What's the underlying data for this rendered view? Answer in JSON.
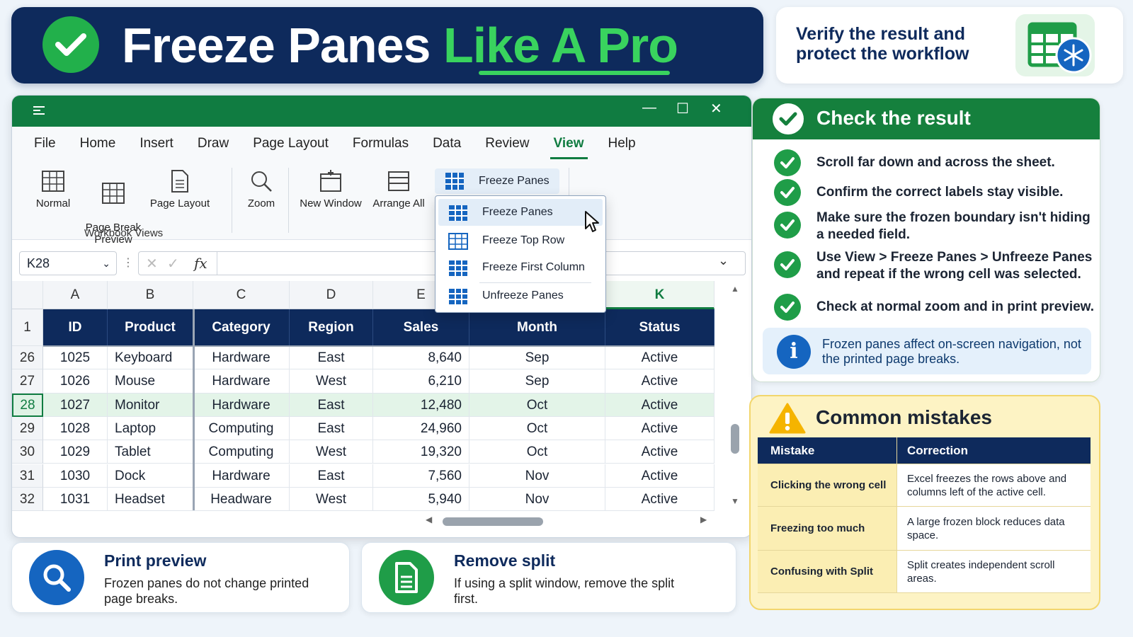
{
  "title": {
    "main": "Freeze Panes",
    "accent": "Like A Pro"
  },
  "verify": {
    "text": "Verify the result and protect the workflow"
  },
  "excel": {
    "menu": [
      "File",
      "Home",
      "Insert",
      "Draw",
      "Page Layout",
      "Formulas",
      "Data",
      "Review",
      "View",
      "Help"
    ],
    "active_menu": "View",
    "ribbon": {
      "normal": "Normal",
      "page_break_preview": "Page Break\nPreview",
      "page_layout": "Page Layout",
      "zoom": "Zoom",
      "new_window": "New Window",
      "arrange_all": "Arrange All",
      "group_label": "Workbook Views",
      "freeze_panes": "Freeze Panes"
    },
    "namebox": "K28",
    "fx": "fx",
    "columns": [
      "A",
      "B",
      "C",
      "D",
      "E",
      "K"
    ],
    "header_row_number": "1",
    "headers": [
      "ID",
      "Product",
      "Category",
      "Region",
      "Sales",
      "Month",
      "Status"
    ],
    "rows": [
      {
        "num": "26",
        "id": "1025",
        "product": "Keyboard",
        "category": "Hardware",
        "region": "East",
        "sales": "8,640",
        "month": "Sep",
        "status": "Active"
      },
      {
        "num": "27",
        "id": "1026",
        "product": "Mouse",
        "category": "Hardware",
        "region": "West",
        "sales": "6,210",
        "month": "Sep",
        "status": "Active"
      },
      {
        "num": "28",
        "id": "1027",
        "product": "Monitor",
        "category": "Hardware",
        "region": "East",
        "sales": "12,480",
        "month": "Oct",
        "status": "Active"
      },
      {
        "num": "29",
        "id": "1028",
        "product": "Laptop",
        "category": "Computing",
        "region": "East",
        "sales": "24,960",
        "month": "Oct",
        "status": "Active"
      },
      {
        "num": "30",
        "id": "1029",
        "product": "Tablet",
        "category": "Computing",
        "region": "West",
        "sales": "19,320",
        "month": "Oct",
        "status": "Active"
      },
      {
        "num": "31",
        "id": "1030",
        "product": "Dock",
        "category": "Hardware",
        "region": "East",
        "sales": "7,560",
        "month": "Nov",
        "status": "Active"
      },
      {
        "num": "32",
        "id": "1031",
        "product": "Headset",
        "category": "Headware",
        "region": "West",
        "sales": "5,940",
        "month": "Nov",
        "status": "Active"
      }
    ],
    "selected_row": "28",
    "dropdown": [
      "Freeze Panes",
      "Freeze Top Row",
      "Freeze First Column",
      "Unfreeze Panes"
    ]
  },
  "check": {
    "title": "Check the result",
    "items": [
      "Scroll far down and across the sheet.",
      "Confirm the correct labels stay visible.",
      "Make sure the frozen boundary isn't hiding a needed field.",
      "Use View > Freeze Panes > Unfreeze Panes and repeat if the wrong cell was selected.",
      "Check at normal zoom and in print preview."
    ],
    "info_icon": "i",
    "info": "Frozen panes affect on-screen navigation, not the printed page breaks."
  },
  "mistakes": {
    "title": "Common mistakes",
    "col_mistake": "Mistake",
    "col_correction": "Correction",
    "rows": [
      {
        "mistake": "Clicking the wrong cell",
        "correction": "Excel freezes the rows above and columns left of the active cell."
      },
      {
        "mistake": "Freezing too much",
        "correction": "A large frozen block reduces data space."
      },
      {
        "mistake": "Confusing with Split",
        "correction": "Split creates independent scroll areas."
      }
    ]
  },
  "cards": {
    "print": {
      "title": "Print preview",
      "text": "Frozen panes do not change printed page breaks."
    },
    "split": {
      "title": "Remove split",
      "text": "If using a split window, remove the split first."
    }
  },
  "colors": {
    "navy": "#0e2a5c",
    "excel_green": "#107c41",
    "accent_green": "#39d35e",
    "warning": "#f5b400",
    "info_blue": "#1565c0"
  }
}
